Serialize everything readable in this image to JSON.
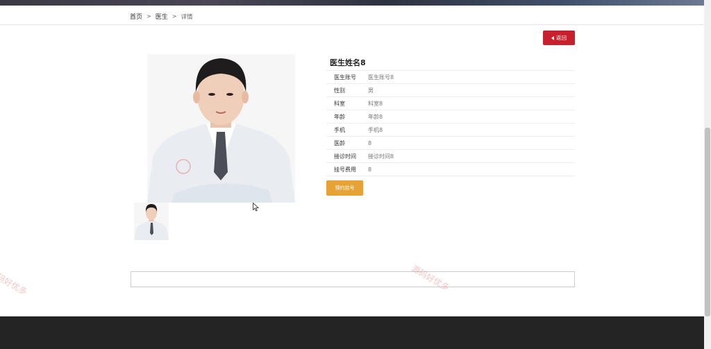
{
  "breadcrumb": {
    "home": "首页",
    "section": "医生",
    "current": "详情",
    "separator": ">"
  },
  "back_button": {
    "label": "返回"
  },
  "doctor": {
    "name": "医生姓名8",
    "fields": [
      {
        "key": "医生账号",
        "value": "医生账号8"
      },
      {
        "key": "性别",
        "value": "男"
      },
      {
        "key": "科室",
        "value": "科室8"
      },
      {
        "key": "年龄",
        "value": "年龄8"
      },
      {
        "key": "手机",
        "value": "手机8"
      },
      {
        "key": "医龄",
        "value": "8"
      },
      {
        "key": "接诊时间",
        "value": "接诊时间8"
      },
      {
        "key": "挂号费用",
        "value": "8"
      }
    ]
  },
  "book_button": {
    "label": "预约挂号"
  },
  "watermarks": [
    "源码好优多",
    "源码好优多"
  ],
  "colors": {
    "accent_red": "#c6202c",
    "book_orange": "#e6a234",
    "footer": "#242424"
  },
  "icons": {
    "back": "caret-left-icon",
    "cursor": "mouse-pointer-icon"
  }
}
